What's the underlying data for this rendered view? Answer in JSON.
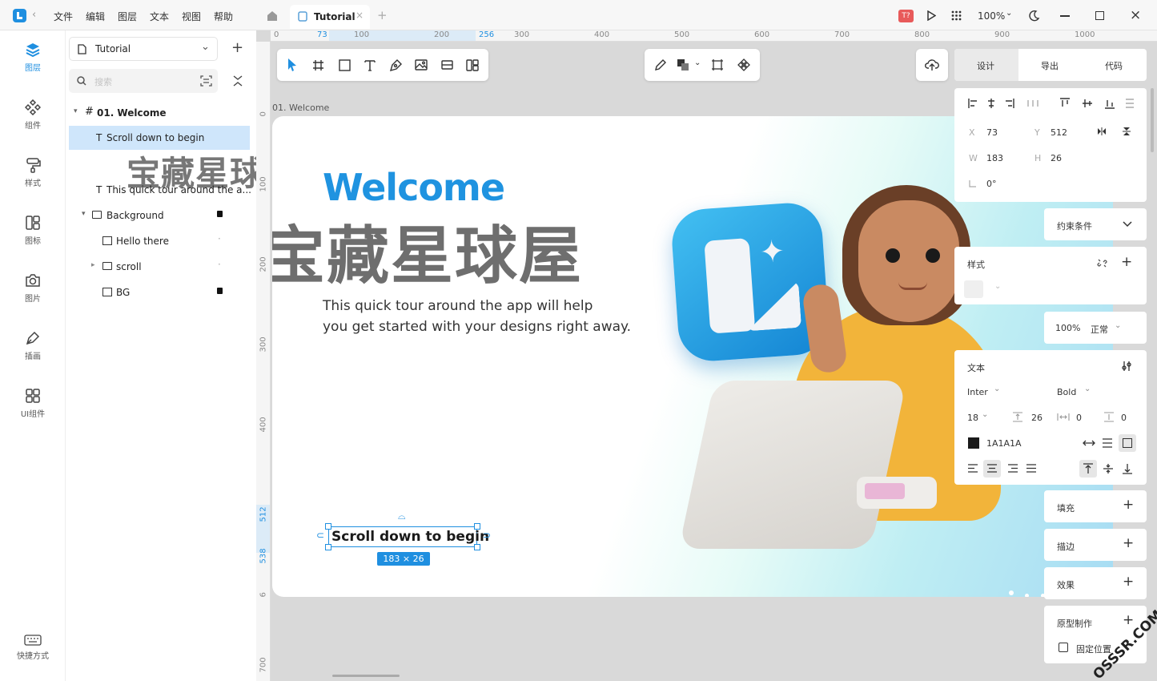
{
  "menu": [
    "文件",
    "编辑",
    "图层",
    "文本",
    "视图",
    "帮助"
  ],
  "tab_title": "Tutorial",
  "zoom": "100%",
  "ruler_top": [
    "0",
    "73",
    "100",
    "200",
    "256",
    "300",
    "400",
    "500",
    "600",
    "700",
    "800",
    "900",
    "1000"
  ],
  "ruler_left": [
    "0",
    "100",
    "200",
    "300",
    "400",
    "512",
    "538",
    "6",
    "700"
  ],
  "nav": [
    {
      "label": "图层",
      "icon": "layers-icon"
    },
    {
      "label": "组件",
      "icon": "components-icon"
    },
    {
      "label": "样式",
      "icon": "styles-icon"
    },
    {
      "label": "图标",
      "icon": "icons-icon"
    },
    {
      "label": "图片",
      "icon": "camera-icon"
    },
    {
      "label": "插画",
      "icon": "pen-icon"
    },
    {
      "label": "UI组件",
      "icon": "ui-grid-icon"
    }
  ],
  "nav_bottom": "快捷方式",
  "layers": {
    "page": "Tutorial",
    "search_placeholder": "搜索",
    "items": [
      {
        "label": "01. Welcome"
      },
      {
        "label": "Scroll down to begin"
      },
      {
        "label": "宝藏星球屋"
      },
      {
        "label": "This quick tour around the a..."
      },
      {
        "label": "Background"
      },
      {
        "label": "Hello there"
      },
      {
        "label": "scroll"
      },
      {
        "label": "BG"
      }
    ]
  },
  "frame": {
    "label": "01. Welcome",
    "heading": "Welcome",
    "watermark": "宝藏星球屋",
    "body_line1": "This quick tour around the app will help",
    "body_line2": "you get started with your designs right away.",
    "selected_text": "Scroll down to begin",
    "size_badge": "183 × 26"
  },
  "right_tabs": [
    "设计",
    "导出",
    "代码"
  ],
  "geometry": {
    "x_label": "X",
    "x": "73",
    "y_label": "Y",
    "y": "512",
    "w_label": "W",
    "w": "183",
    "h_label": "H",
    "h": "26",
    "rotation": "0°"
  },
  "constraints": "约束条件",
  "style_title": "样式",
  "opacity": "100%",
  "blend": "正常",
  "text_panel": {
    "title": "文本",
    "font": "Inter",
    "weight": "Bold",
    "size": "18",
    "line_height": "26",
    "letter_spacing": "0",
    "paragraph_spacing": "0",
    "color": "1A1A1A"
  },
  "fill": "填充",
  "stroke": "描边",
  "effect": "效果",
  "prototype": "原型制作",
  "fixed_position": "固定位置",
  "corner_watermark": "OSSSR.COM",
  "colors": {
    "accent": "#1f8fe0",
    "selection": "#cfe6fb",
    "welcome": "#1f93e0",
    "text_color": "#1A1A1A"
  }
}
